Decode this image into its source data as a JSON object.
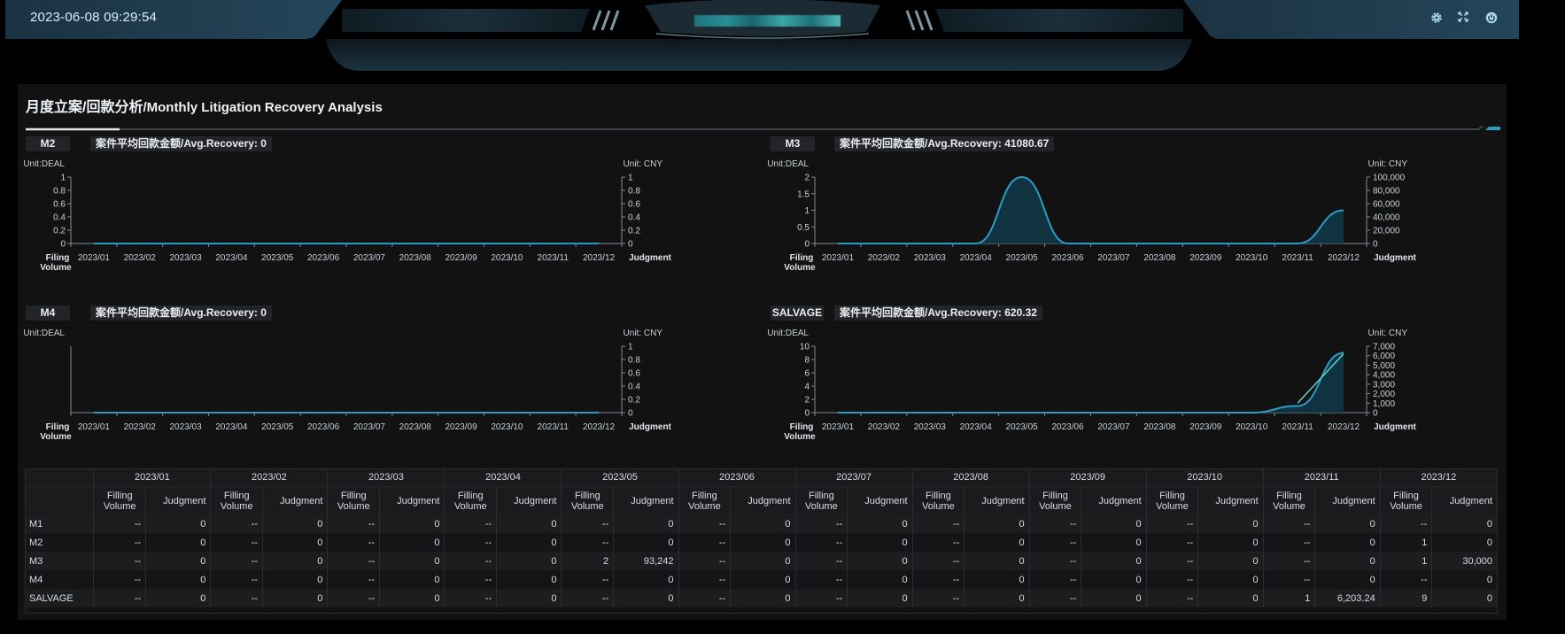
{
  "header": {
    "datetime": "2023-06-08 09:29:54",
    "icons": [
      "gear-icon",
      "fullscreen-icon",
      "power-icon"
    ]
  },
  "colors": {
    "accent": "#2c9bc4",
    "area_fill": "#0f3a4a",
    "line_judgment": "#5fd6c8",
    "axis": "#7f8a91",
    "background": "#121213"
  },
  "panel": {
    "title_cn": "月度立案/回款分析",
    "title_en": "/Monthly Litigation Recovery Analysis"
  },
  "chart_data": [
    {
      "type": "area",
      "name": "M2",
      "badge": "M2",
      "avg_label": "案件平均回款金额/Avg.Recovery: 0",
      "left_unit": "Unit:DEAL",
      "right_unit": "Unit: CNY",
      "xlabel_left": [
        "Filing",
        "Volume"
      ],
      "xlabel_right": "Judgment",
      "categories": [
        "2023/01",
        "2023/02",
        "2023/03",
        "2023/04",
        "2023/05",
        "2023/06",
        "2023/07",
        "2023/08",
        "2023/09",
        "2023/10",
        "2023/11",
        "2023/12"
      ],
      "left_ticks": [
        "0",
        "0.2",
        "0.4",
        "0.6",
        "0.8",
        "1"
      ],
      "right_ticks": [
        "0",
        "0.2",
        "0.4",
        "0.6",
        "0.8",
        "1"
      ],
      "ylim_left": [
        0,
        1
      ],
      "ylim_right": [
        0,
        1
      ],
      "series": [
        {
          "name": "Filing Volume",
          "axis": "left",
          "values": [
            0,
            0,
            0,
            0,
            0,
            0,
            0,
            0,
            0,
            0,
            0,
            0
          ]
        },
        {
          "name": "Judgment",
          "axis": "right",
          "values": [
            0,
            0,
            0,
            0,
            0,
            0,
            0,
            0,
            0,
            0,
            0,
            0
          ]
        }
      ]
    },
    {
      "type": "area",
      "name": "M3",
      "badge": "M3",
      "avg_label": "案件平均回款金额/Avg.Recovery: 41080.67",
      "left_unit": "Unit:DEAL",
      "right_unit": "Unit: CNY",
      "xlabel_left": [
        "Filing",
        "Volume"
      ],
      "xlabel_right": "Judgment",
      "categories": [
        "2023/01",
        "2023/02",
        "2023/03",
        "2023/04",
        "2023/05",
        "2023/06",
        "2023/07",
        "2023/08",
        "2023/09",
        "2023/10",
        "2023/11",
        "2023/12"
      ],
      "left_ticks": [
        "0",
        "0.5",
        "1",
        "1.5",
        "2"
      ],
      "right_ticks": [
        "0",
        "20,000",
        "40,000",
        "60,000",
        "80,000",
        "100,000"
      ],
      "ylim_left": [
        0,
        2
      ],
      "ylim_right": [
        0,
        100000
      ],
      "series": [
        {
          "name": "Filing Volume",
          "axis": "left",
          "values": [
            0,
            0,
            0,
            0,
            2,
            0,
            0,
            0,
            0,
            0,
            0,
            1
          ]
        },
        {
          "name": "Judgment",
          "axis": "right",
          "values": [
            0,
            0,
            0,
            0,
            93242,
            0,
            0,
            0,
            0,
            0,
            0,
            30000
          ]
        }
      ]
    },
    {
      "type": "area",
      "name": "M4",
      "badge": "M4",
      "avg_label": "案件平均回款金额/Avg.Recovery: 0",
      "left_unit": "Unit:DEAL",
      "right_unit": "Unit: CNY",
      "xlabel_left": [
        "Filing",
        "Volume"
      ],
      "xlabel_right": "Judgment",
      "categories": [
        "2023/01",
        "2023/02",
        "2023/03",
        "2023/04",
        "2023/05",
        "2023/06",
        "2023/07",
        "2023/08",
        "2023/09",
        "2023/10",
        "2023/11",
        "2023/12"
      ],
      "left_ticks": [],
      "right_ticks": [
        "0",
        "0.2",
        "0.4",
        "0.6",
        "0.8",
        "1"
      ],
      "ylim_left": [
        0,
        1
      ],
      "ylim_right": [
        0,
        1
      ],
      "series": [
        {
          "name": "Filing Volume",
          "axis": "left",
          "values": [
            0,
            0,
            0,
            0,
            0,
            0,
            0,
            0,
            0,
            0,
            0,
            0
          ]
        },
        {
          "name": "Judgment",
          "axis": "right",
          "values": [
            0,
            0,
            0,
            0,
            0,
            0,
            0,
            0,
            0,
            0,
            0,
            0
          ]
        }
      ]
    },
    {
      "type": "area",
      "name": "SALVAGE",
      "badge": "SALVAGE",
      "avg_label": "案件平均回款金额/Avg.Recovery: 620.32",
      "left_unit": "Unit:DEAL",
      "right_unit": "Unit: CNY",
      "xlabel_left": [
        "Filing",
        "Volume"
      ],
      "xlabel_right": "Judgment",
      "categories": [
        "2023/01",
        "2023/02",
        "2023/03",
        "2023/04",
        "2023/05",
        "2023/06",
        "2023/07",
        "2023/08",
        "2023/09",
        "2023/10",
        "2023/11",
        "2023/12"
      ],
      "left_ticks": [
        "0",
        "2",
        "4",
        "6",
        "8",
        "10"
      ],
      "right_ticks": [
        "0",
        "1,000",
        "2,000",
        "3,000",
        "4,000",
        "5,000",
        "6,000",
        "7,000"
      ],
      "ylim_left": [
        0,
        10
      ],
      "ylim_right": [
        0,
        7000
      ],
      "series": [
        {
          "name": "Filing Volume",
          "axis": "left",
          "values": [
            0,
            0,
            0,
            0,
            0,
            0,
            0,
            0,
            0,
            0,
            1,
            9
          ]
        },
        {
          "name": "Judgment",
          "axis": "right",
          "values": [
            0,
            0,
            0,
            0,
            0,
            0,
            0,
            0,
            0,
            0,
            0,
            0
          ]
        }
      ],
      "judgment_line": {
        "x": [
          "2023/11",
          "2023/12"
        ],
        "values": [
          1000,
          6203.24
        ]
      }
    }
  ],
  "table": {
    "months": [
      "2023/01",
      "2023/02",
      "2023/03",
      "2023/04",
      "2023/05",
      "2023/06",
      "2023/07",
      "2023/08",
      "2023/09",
      "2023/10",
      "2023/11",
      "2023/12"
    ],
    "sub_headers": {
      "filling": [
        "Filling",
        "Volume"
      ],
      "judgment": "Judgment"
    },
    "rows": [
      {
        "label": "M1",
        "cells": [
          "--",
          "0",
          "--",
          "0",
          "--",
          "0",
          "--",
          "0",
          "--",
          "0",
          "--",
          "0",
          "--",
          "0",
          "--",
          "0",
          "--",
          "0",
          "--",
          "0",
          "--",
          "0",
          "--",
          "0"
        ]
      },
      {
        "label": "M2",
        "cells": [
          "--",
          "0",
          "--",
          "0",
          "--",
          "0",
          "--",
          "0",
          "--",
          "0",
          "--",
          "0",
          "--",
          "0",
          "--",
          "0",
          "--",
          "0",
          "--",
          "0",
          "--",
          "0",
          "1",
          "0"
        ]
      },
      {
        "label": "M3",
        "cells": [
          "--",
          "0",
          "--",
          "0",
          "--",
          "0",
          "--",
          "0",
          "2",
          "93,242",
          "--",
          "0",
          "--",
          "0",
          "--",
          "0",
          "--",
          "0",
          "--",
          "0",
          "--",
          "0",
          "1",
          "30,000"
        ]
      },
      {
        "label": "M4",
        "cells": [
          "--",
          "0",
          "--",
          "0",
          "--",
          "0",
          "--",
          "0",
          "--",
          "0",
          "--",
          "0",
          "--",
          "0",
          "--",
          "0",
          "--",
          "0",
          "--",
          "0",
          "--",
          "0",
          "--",
          "0"
        ]
      },
      {
        "label": "SALVAGE",
        "cells": [
          "--",
          "0",
          "--",
          "0",
          "--",
          "0",
          "--",
          "0",
          "--",
          "0",
          "--",
          "0",
          "--",
          "0",
          "--",
          "0",
          "--",
          "0",
          "--",
          "0",
          "1",
          "6,203.24",
          "9",
          "0"
        ]
      }
    ]
  }
}
